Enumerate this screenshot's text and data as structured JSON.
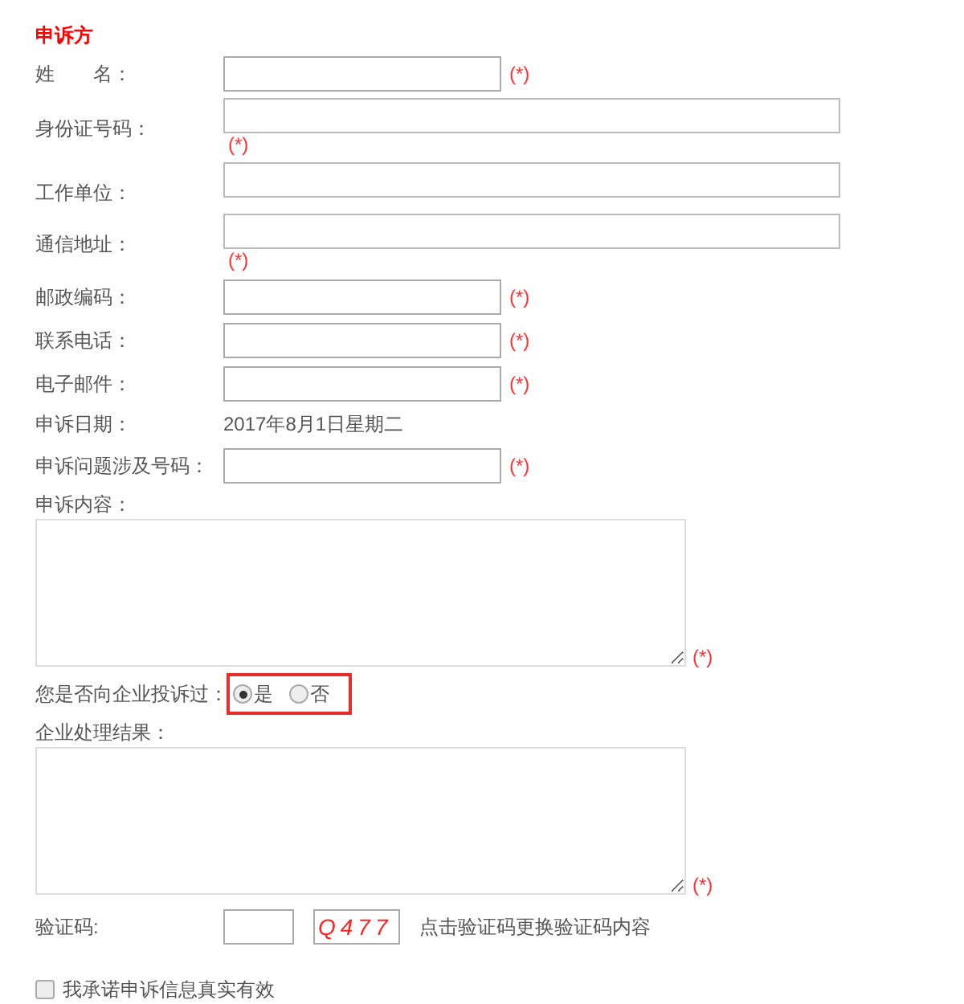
{
  "section_title": "申诉方",
  "fields": [
    {
      "kind": "short",
      "label": "姓　　名：",
      "required": "(*)"
    },
    {
      "kind": "long",
      "label": "身份证号码：",
      "required": "(*)"
    },
    {
      "kind": "long",
      "label": "工作单位："
    },
    {
      "kind": "long",
      "label": "通信地址：",
      "required": "(*)"
    },
    {
      "kind": "short",
      "label": "邮政编码：",
      "required": "(*)"
    },
    {
      "kind": "short",
      "label": "联系电话：",
      "required": "(*)"
    },
    {
      "kind": "short",
      "label": "电子邮件：",
      "required": "(*)"
    },
    {
      "kind": "static",
      "label": "申诉日期：",
      "value": "2017年8月1日星期二"
    },
    {
      "kind": "short",
      "label": "申诉问题涉及号码：",
      "required": "(*)"
    }
  ],
  "complaint_content": {
    "label": "申诉内容：",
    "required": "(*)"
  },
  "complained_to_company": {
    "label": "您是否向企业投诉过：",
    "highlighted": true,
    "options": [
      {
        "label": "是",
        "selected": true
      },
      {
        "label": "否",
        "selected": false
      }
    ]
  },
  "company_result": {
    "label": "企业处理结果：",
    "required": "(*)"
  },
  "captcha": {
    "label": "验证码:",
    "code": "Q477",
    "hint": "点击验证码更换验证码内容"
  },
  "agreement": {
    "label": "我承诺申诉信息真实有效",
    "checked": false
  }
}
